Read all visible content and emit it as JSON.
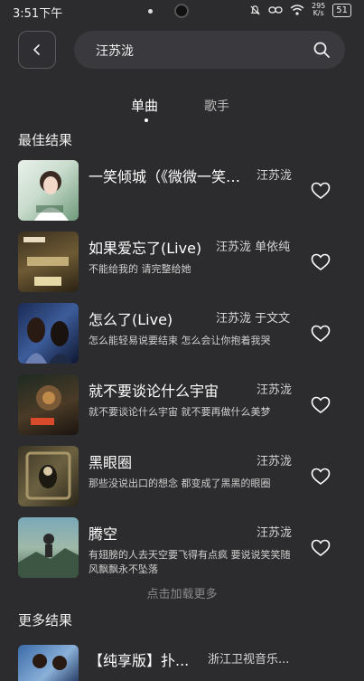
{
  "status_bar": {
    "time": "3:51下午",
    "speed_top": "295",
    "speed_bottom": "K/s",
    "battery": "51"
  },
  "search": {
    "value": "汪苏泷"
  },
  "tabs": [
    {
      "label": "单曲",
      "active": true
    },
    {
      "label": "歌手",
      "active": false
    }
  ],
  "best_results": {
    "title": "最佳结果",
    "songs": [
      {
        "title": "一笑倾城（《微微一笑很倾城》",
        "artist": "汪苏泷",
        "lyric": ""
      },
      {
        "title": "如果爱忘了(Live)",
        "artist": "汪苏泷 单依纯",
        "lyric": "不能给我的 请完整给她"
      },
      {
        "title": "怎么了(Live)",
        "artist": "汪苏泷 于文文",
        "lyric": "怎么能轻易说要结束 怎么会让你抱着我哭"
      },
      {
        "title": "就不要谈论什么宇宙",
        "artist": "汪苏泷",
        "lyric": "就不要谈论什么宇宙 就不要再做什么美梦"
      },
      {
        "title": "黑眼圈",
        "artist": "汪苏泷",
        "lyric": "那些没说出口的想念 都变成了黑黑的眼圈"
      },
      {
        "title": "腾空",
        "artist": "汪苏泷",
        "lyric": "有翅膀的人去天空要飞得有点疯 要说说笑笑随风飘飘永不坠落"
      }
    ],
    "load_more": "点击加载更多"
  },
  "more_results": {
    "title": "更多结果",
    "items": [
      {
        "title": "【纯享版】扑...",
        "artist": "浙江卫视音乐..."
      }
    ]
  }
}
